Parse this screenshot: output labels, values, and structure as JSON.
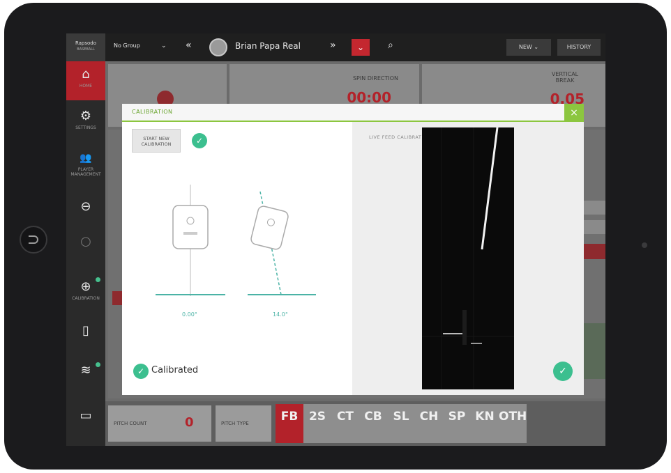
{
  "app": {
    "logo_text": "Rapsodo",
    "logo_sub": "BASEBALL"
  },
  "topbar": {
    "group_label": "No Group",
    "player_name": "Brian Papa Real",
    "new_label": "NEW",
    "history_label": "HISTORY"
  },
  "sidebar": {
    "items": [
      {
        "label": "HOME",
        "icon": "home-icon"
      },
      {
        "label": "SETTINGS",
        "icon": "gear-icon"
      },
      {
        "label": "PLAYER MANAGEMENT",
        "icon": "players-icon"
      },
      {
        "label": "",
        "icon": "record-icon"
      },
      {
        "label": "",
        "icon": "circle-icon"
      },
      {
        "label": "CALIBRATION",
        "icon": "target-icon"
      },
      {
        "label": "",
        "icon": "device-icon"
      },
      {
        "label": "",
        "icon": "wifi-icon"
      },
      {
        "label": "",
        "icon": "battery-icon"
      }
    ]
  },
  "stats": {
    "spin_direction_label": "SPIN DIRECTION",
    "spin_direction_value": "00:00",
    "vertical_break_label": "VERTICAL BREAK",
    "vertical_break_value": "0.05"
  },
  "bottom": {
    "pitch_count_label": "PITCH COUNT",
    "pitch_count_value": "0",
    "pitch_type_label": "PITCH TYPE",
    "pitch_types": [
      {
        "code": "FB",
        "selected": true
      },
      {
        "code": "2S",
        "selected": false
      },
      {
        "code": "CT",
        "selected": false
      },
      {
        "code": "CB",
        "selected": false
      },
      {
        "code": "SL",
        "selected": false
      },
      {
        "code": "CH",
        "selected": false
      },
      {
        "code": "SP",
        "selected": false
      },
      {
        "code": "KN",
        "selected": false
      },
      {
        "code": "OTH",
        "selected": false
      }
    ]
  },
  "modal": {
    "title": "CALIBRATION",
    "close_label": "×",
    "start_button_label": "START NEW CALIBRATION",
    "angle_left": "0.00°",
    "angle_right": "14.0°",
    "calibrated_label": "Calibrated",
    "live_label": "LIVE FEED CALIBRATION"
  },
  "colors": {
    "brand_red": "#b3222a",
    "accent_green": "#8cc63f",
    "check_teal": "#3cbf8f"
  }
}
